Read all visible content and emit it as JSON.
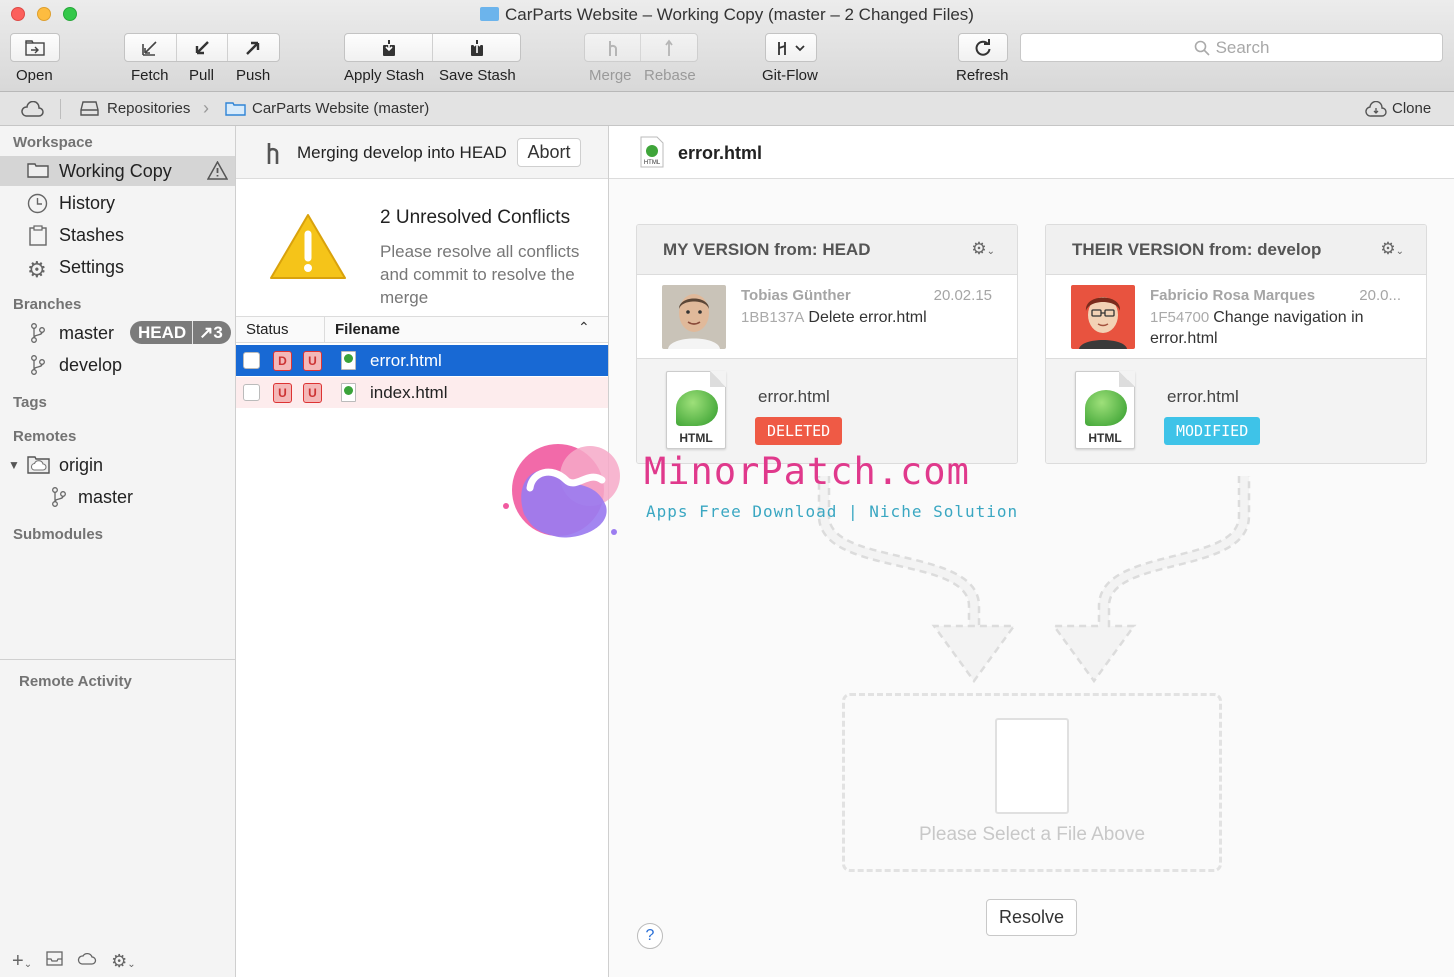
{
  "window": {
    "title": "CarParts Website – Working Copy (master – 2 Changed Files)"
  },
  "toolbar": {
    "open": "Open",
    "fetch": "Fetch",
    "pull": "Pull",
    "push": "Push",
    "apply_stash": "Apply Stash",
    "save_stash": "Save Stash",
    "merge": "Merge",
    "rebase": "Rebase",
    "git_flow": "Git-Flow",
    "refresh": "Refresh",
    "search_placeholder": "Search"
  },
  "breadcrumb": {
    "repositories": "Repositories",
    "repo": "CarParts Website (master)",
    "clone": "Clone"
  },
  "sidebar": {
    "workspace_heading": "Workspace",
    "workspace_items": [
      "Working Copy",
      "History",
      "Stashes",
      "Settings"
    ],
    "branches_heading": "Branches",
    "branches": [
      {
        "name": "master",
        "badge_head": "HEAD",
        "badge_count": "↗3"
      },
      {
        "name": "develop"
      }
    ],
    "tags_heading": "Tags",
    "remotes_heading": "Remotes",
    "remote_name": "origin",
    "remote_branch": "master",
    "submodules_heading": "Submodules",
    "remote_activity_heading": "Remote Activity"
  },
  "merge": {
    "status_text": "Merging develop into HEAD",
    "abort_label": "Abort",
    "conflict_title": "2 Unresolved Conflicts",
    "conflict_desc": "Please resolve all conflicts and commit to resolve the merge"
  },
  "file_list": {
    "col_status": "Status",
    "col_filename": "Filename",
    "files": [
      {
        "status": [
          "D",
          "U"
        ],
        "name": "error.html"
      },
      {
        "status": [
          "U",
          "U"
        ],
        "name": "index.html"
      }
    ]
  },
  "detail": {
    "file_title": "error.html",
    "mine": {
      "title": "MY VERSION from: HEAD",
      "author": "Tobias Günther",
      "date": "20.02.15",
      "sha": "1BB137A",
      "message": "Delete error.html",
      "filename": "error.html",
      "file_label": "HTML",
      "state": "DELETED",
      "state_color": "#ef5a45"
    },
    "theirs": {
      "title": "THEIR VERSION from: develop",
      "author": "Fabricio Rosa Marques",
      "date": "20.0...",
      "sha": "1F54700",
      "message": "Change navigation in error.html",
      "filename": "error.html",
      "file_label": "HTML",
      "state": "MODIFIED",
      "state_color": "#3ec3e8"
    },
    "placeholder": "Please Select a File Above",
    "resolve_label": "Resolve",
    "help_label": "?"
  },
  "watermark": {
    "title": "MinorPatch.com",
    "subtitle": "Apps Free Download | Niche Solution"
  }
}
